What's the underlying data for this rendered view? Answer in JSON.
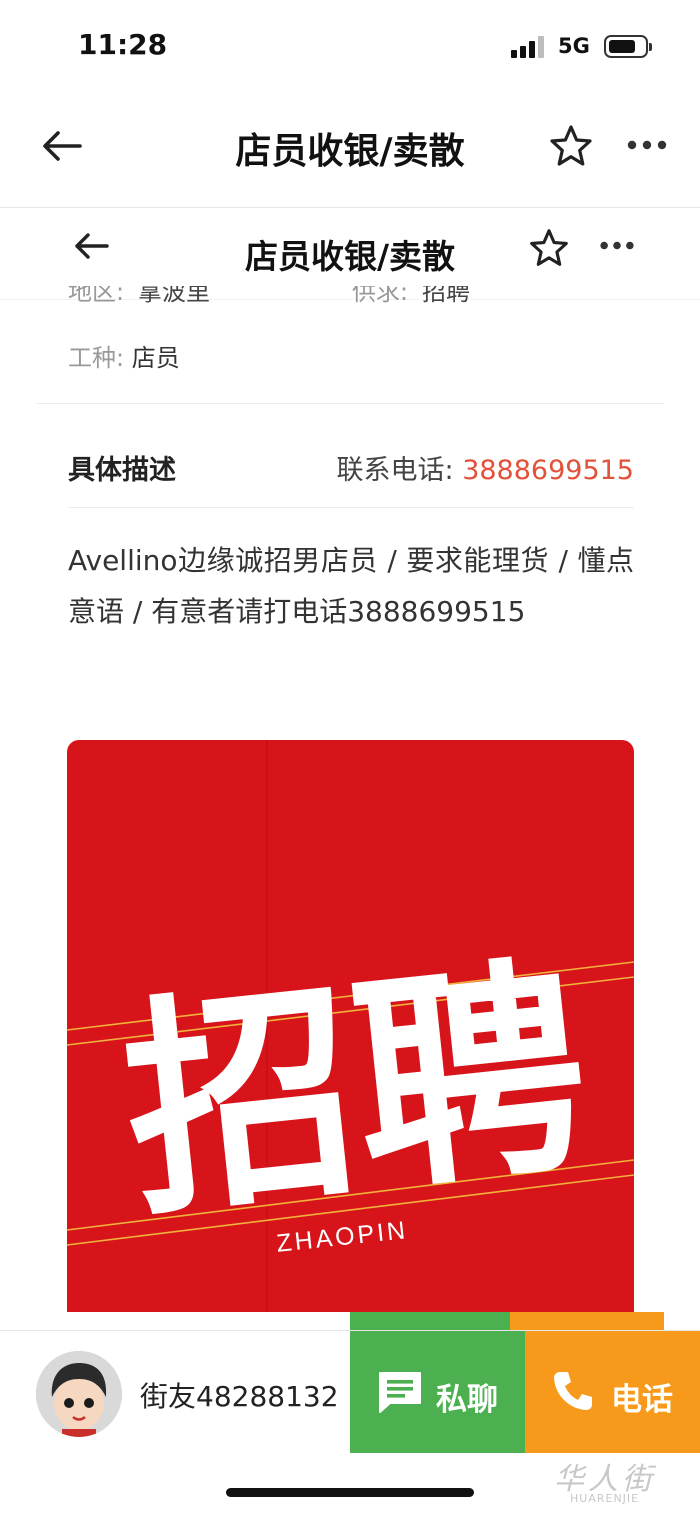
{
  "status_bar": {
    "time": "11:28",
    "network": "5G"
  },
  "header": {
    "title": "店员收银/卖散"
  },
  "subheader": {
    "title": "店员收银/卖散"
  },
  "cut_row": {
    "area_label": "地区:",
    "area_value": "拿波里",
    "supply_label": "供求:",
    "supply_value": "招聘"
  },
  "job_type": {
    "label": "工种:",
    "value": "店员"
  },
  "description": {
    "title": "具体描述",
    "phone_label": "联系电话:",
    "phone_number": "3888699515",
    "body": "Avellino边缘诚招男店员 / 要求能理货 / 懂点意语 / 有意者请打电话3888699515"
  },
  "poster": {
    "headline": "招聘",
    "subtitle": "ZHAOPIN"
  },
  "bottom_bar": {
    "username": "街友48288132",
    "chat_label": "私聊",
    "call_label": "电话"
  },
  "watermark": {
    "text": "华人街",
    "sub": "HUARENJIE"
  },
  "colors": {
    "accent_red": "#e2513a",
    "poster_red": "#d8141b",
    "chat_green": "#4caf50",
    "call_orange": "#f79a1b"
  },
  "icons": [
    "back-arrow-icon",
    "star-icon",
    "more-icon",
    "chat-icon",
    "phone-icon",
    "signal-icon",
    "battery-icon"
  ]
}
